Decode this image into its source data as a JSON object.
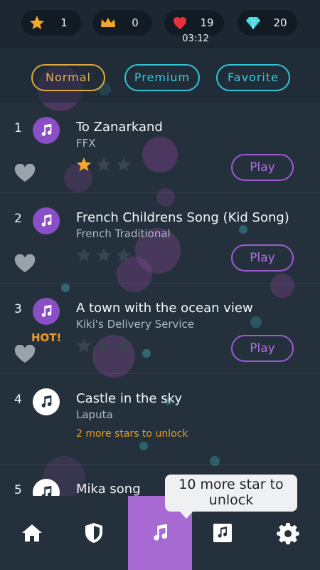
{
  "stats": {
    "stars": "1",
    "crowns": "0",
    "lives": "19",
    "diamonds": "20",
    "timer": "03:12"
  },
  "tabs": {
    "normal": "Normal",
    "premium": "Premium",
    "favorite": "Favorite"
  },
  "songs": [
    {
      "num": "1",
      "title": "To Zanarkand",
      "artist": "FFX",
      "stars_earned": 1,
      "stars_total": 3,
      "play": "Play",
      "hot": "",
      "locked": false
    },
    {
      "num": "2",
      "title": "French Childrens Song (Kid Song)",
      "artist": "French Traditional",
      "stars_earned": 0,
      "stars_total": 3,
      "play": "Play",
      "hot": "",
      "locked": false
    },
    {
      "num": "3",
      "title": "A town with the ocean view",
      "artist": "Kiki's Delivery Service",
      "stars_earned": 0,
      "stars_total": 3,
      "play": "Play",
      "hot": "HOT!",
      "locked": false
    },
    {
      "num": "4",
      "title": "Castle in the sky",
      "artist": "Laputa",
      "unlock_text": "2 more stars to unlock",
      "locked": true
    },
    {
      "num": "5",
      "title": "Mika song",
      "locked": true
    }
  ],
  "tooltip": {
    "line1": "10 more star to",
    "line2": "unlock"
  },
  "nav": {
    "items": [
      {
        "icon": "home-icon",
        "active": false
      },
      {
        "icon": "shield-icon",
        "active": false
      },
      {
        "icon": "music-note-icon",
        "active": true
      },
      {
        "icon": "music-album-icon",
        "active": false
      },
      {
        "icon": "gear-icon",
        "active": false
      }
    ]
  },
  "colors": {
    "background": "#24313d",
    "topbar": "#1c2731",
    "normal_tab": "#e0a93a",
    "other_tabs": "#2ec6d6",
    "accent_purple": "#a769d2",
    "heart_red": "#e8303c",
    "diamond_cyan": "#3fd6e4",
    "star_gold": "#f3a92b",
    "hot_orange": "#f09a2c"
  }
}
